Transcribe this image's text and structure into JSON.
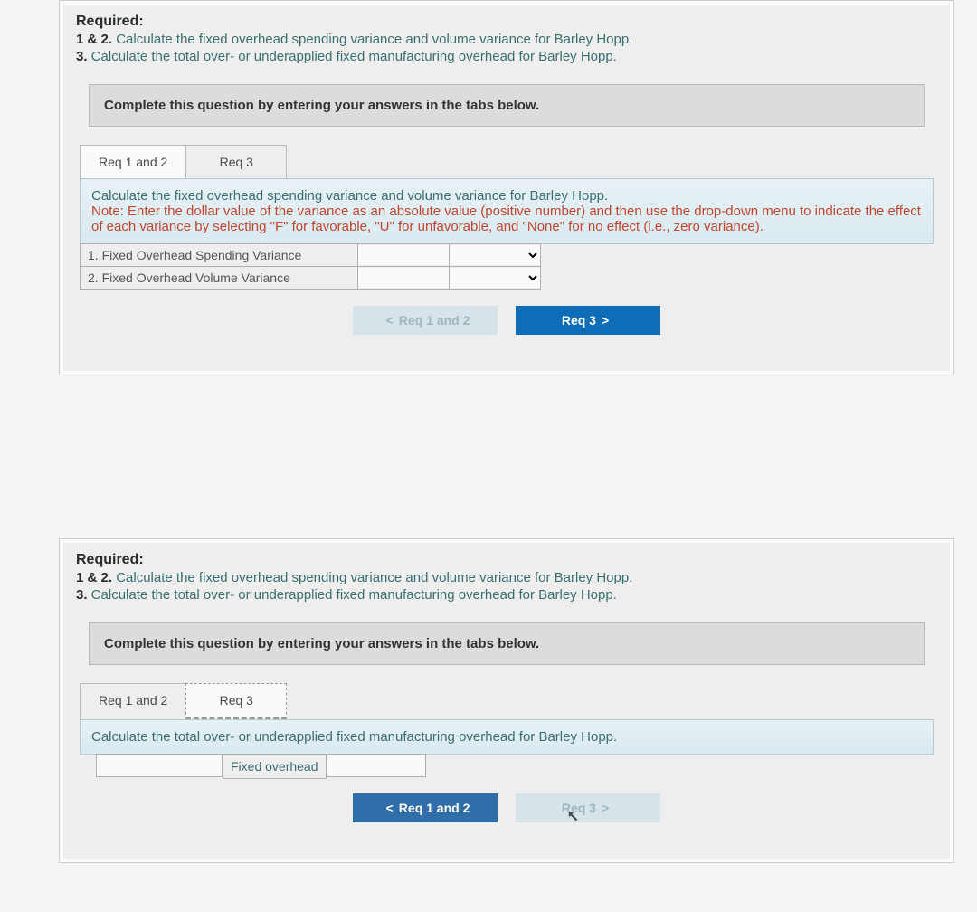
{
  "panel1": {
    "required_label": "Required:",
    "req_line1_num": "1 & 2.",
    "req_line1_text": " Calculate the fixed overhead spending variance and volume variance for Barley Hopp.",
    "req_line2_num": "3.",
    "req_line2_text": " Calculate the total over- or underapplied fixed manufacturing overhead for Barley Hopp.",
    "instruction": "Complete this question by entering your answers in the tabs below.",
    "tab1": "Req 1 and 2",
    "tab2": "Req 3",
    "prompt_main": "Calculate the fixed overhead spending variance and volume variance for Barley Hopp.",
    "prompt_note": "Note: Enter the dollar value of the variance as an absolute value (positive number) and then use the drop-down menu to indicate the effect of each variance by selecting \"F\" for favorable, \"U\" for unfavorable, and \"None\" for no effect (i.e., zero variance).",
    "row1_label": "1. Fixed Overhead Spending Variance",
    "row2_label": "2. Fixed Overhead Volume Variance",
    "nav_prev": "Req 1 and 2",
    "nav_next": "Req 3"
  },
  "panel2": {
    "required_label": "Required:",
    "req_line1_num": "1 & 2.",
    "req_line1_text": " Calculate the fixed overhead spending variance and volume variance for Barley Hopp.",
    "req_line2_num": "3.",
    "req_line2_text": " Calculate the total over- or underapplied fixed manufacturing overhead for Barley Hopp.",
    "instruction": "Complete this question by entering your answers in the tabs below.",
    "tab1": "Req 1 and 2",
    "tab2": "Req 3",
    "prompt_main": "Calculate the total over- or underapplied fixed manufacturing overhead for Barley Hopp.",
    "fixed_label": "Fixed overhead",
    "nav_prev": "Req 1 and 2",
    "nav_next": "Req 3"
  }
}
